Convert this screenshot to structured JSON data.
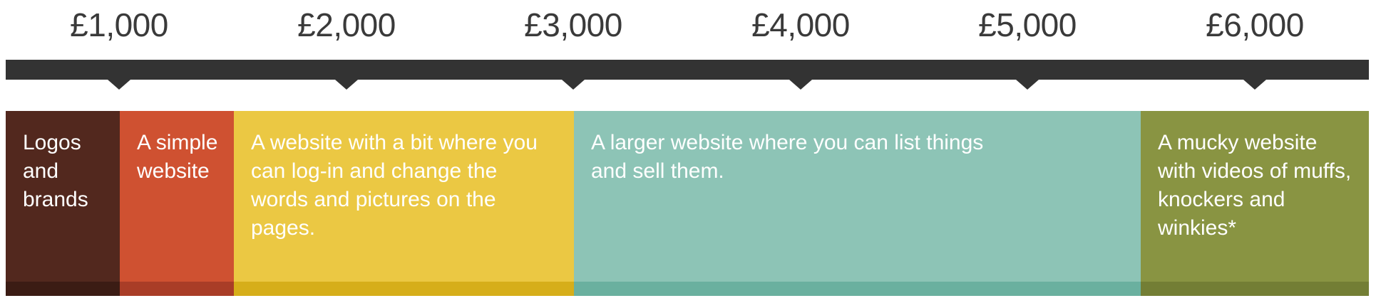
{
  "prices": [
    "£1,000",
    "£2,000",
    "£3,000",
    "£4,000",
    "£5,000",
    "£6,000"
  ],
  "tiers": [
    {
      "text": "Logos and brands",
      "color": "#52281e",
      "shade": "#3b1c14"
    },
    {
      "text": "A simple website",
      "color": "#cf5131",
      "shade": "#a93d27"
    },
    {
      "text": "A website with a bit where you can log-in and change the words and pictures on the pages.",
      "color": "#ebc843",
      "shade": "#d6ae1a"
    },
    {
      "text": "A larger website where you can list things and sell them.",
      "color": "#8dc4b6",
      "shade": "#6ab09f"
    },
    {
      "text": "A mucky website with videos of muffs, knockers and winkies*",
      "color": "#899442",
      "shade": "#737e35"
    }
  ]
}
